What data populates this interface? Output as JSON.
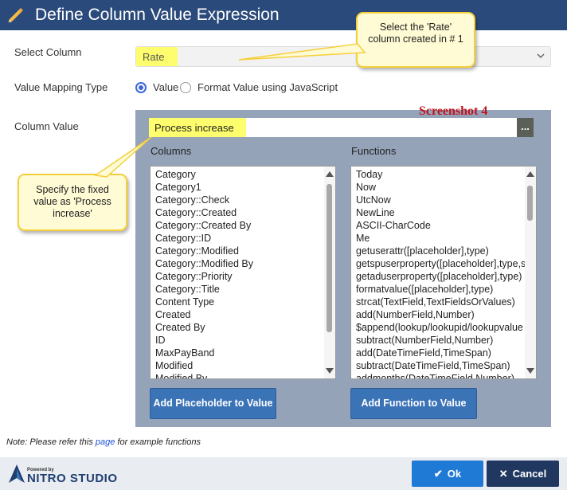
{
  "dialog": {
    "title": "Define Column Value Expression"
  },
  "form": {
    "select_column_label": "Select Column",
    "select_column_value": "Rate",
    "mapping_type_label": "Value Mapping Type",
    "mapping_options": [
      {
        "label": "Value",
        "selected": true
      },
      {
        "label": "Format Value using JavaScript",
        "selected": false
      }
    ],
    "column_value_label": "Column Value",
    "column_value": "Process increase",
    "dots_label": "..."
  },
  "annotation": {
    "screenshot_label": "Screenshot 4",
    "callout_select": "Select the 'Rate' column created in # 1",
    "callout_value": "Specify the fixed value as 'Process increase'",
    "highlight_color": "#fdfd6d",
    "callout_border": "#f5cf3b",
    "arrow_color": "#c0392b"
  },
  "columns": {
    "header": "Columns",
    "items": [
      "Category",
      "Category1",
      "Category::Check",
      "Category::Created",
      "Category::Created By",
      "Category::ID",
      "Category::Modified",
      "Category::Modified By",
      "Category::Priority",
      "Category::Title",
      "Content Type",
      "Created",
      "Created By",
      "ID",
      "MaxPayBand",
      "Modified",
      "Modified By"
    ],
    "button": "Add Placeholder to Value"
  },
  "functions": {
    "header": "Functions",
    "items": [
      "Today",
      "Now",
      "UtcNow",
      "NewLine",
      "ASCII-CharCode",
      "Me",
      "getuserattr([placeholder],type)",
      "getspuserproperty([placeholder],type,s",
      "getaduserproperty([placeholder],type)",
      "formatvalue([placeholder],type)",
      "strcat(TextField,TextFieldsOrValues)",
      "add(NumberField,Number)",
      "$append(lookup/lookupid/lookupvalue",
      "subtract(NumberField,Number)",
      "add(DateTimeField,TimeSpan)",
      "subtract(DateTimeField,TimeSpan)",
      "addmonths(DateTimeField,Number)"
    ],
    "button": "Add Function to Value"
  },
  "note": {
    "prefix": "Note: Please refer this ",
    "link": "page",
    "suffix": " for example functions"
  },
  "footer": {
    "powered_by": "Powered by",
    "brand": "NITRO STUDIO",
    "ok_label": "Ok",
    "cancel_label": "Cancel"
  },
  "icons": {
    "title": "pencil-icon",
    "ok": "check-icon",
    "cancel": "close-icon",
    "select": "chevron-down-icon",
    "logo": "nitro-logo-icon"
  },
  "colors": {
    "titlebar": "#2a4a7b",
    "panel": "#95a3b9",
    "button_blue": "#3b73b7",
    "ok_blue": "#1f7ad6",
    "cancel_navy": "#203760"
  }
}
